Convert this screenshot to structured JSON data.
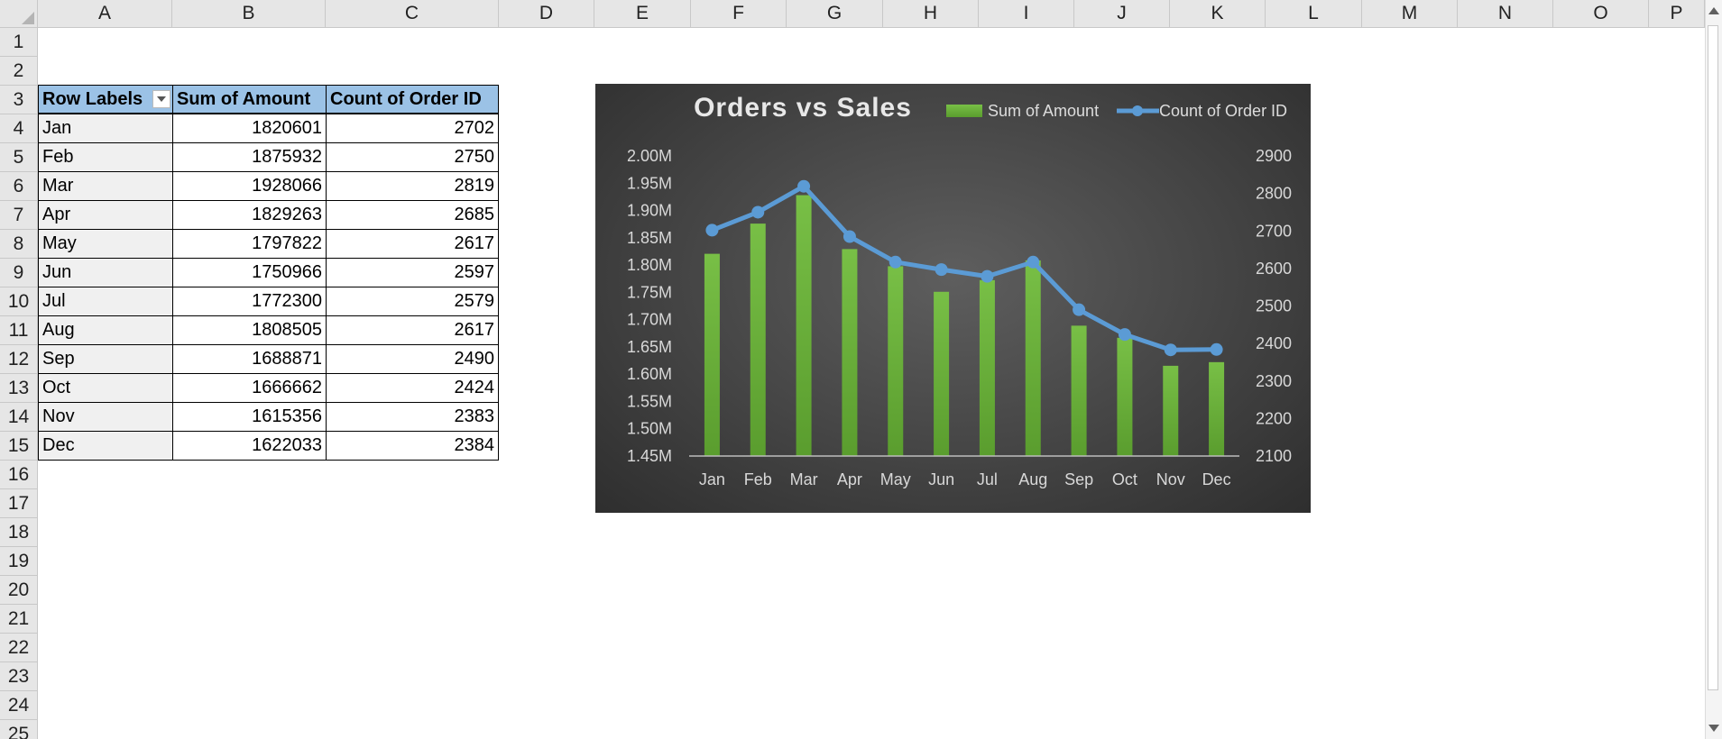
{
  "columns": [
    "A",
    "B",
    "C",
    "D",
    "E",
    "F",
    "G",
    "H",
    "I",
    "J",
    "K",
    "L",
    "M",
    "N",
    "O",
    "P"
  ],
  "rows": [
    "1",
    "2",
    "3",
    "4",
    "5",
    "6",
    "7",
    "8",
    "9",
    "10",
    "11",
    "12",
    "13",
    "14",
    "15",
    "16",
    "17",
    "18",
    "19",
    "20",
    "21",
    "22",
    "23",
    "24",
    "25"
  ],
  "pivot": {
    "headers": [
      "Row Labels",
      "Sum of Amount",
      "Count of Order ID"
    ],
    "rows": [
      {
        "label": "Jan",
        "amount": "1820601",
        "count": "2702"
      },
      {
        "label": "Feb",
        "amount": "1875932",
        "count": "2750"
      },
      {
        "label": "Mar",
        "amount": "1928066",
        "count": "2819"
      },
      {
        "label": "Apr",
        "amount": "1829263",
        "count": "2685"
      },
      {
        "label": "May",
        "amount": "1797822",
        "count": "2617"
      },
      {
        "label": "Jun",
        "amount": "1750966",
        "count": "2597"
      },
      {
        "label": "Jul",
        "amount": "1772300",
        "count": "2579"
      },
      {
        "label": "Aug",
        "amount": "1808505",
        "count": "2617"
      },
      {
        "label": "Sep",
        "amount": "1688871",
        "count": "2490"
      },
      {
        "label": "Oct",
        "amount": "1666662",
        "count": "2424"
      },
      {
        "label": "Nov",
        "amount": "1615356",
        "count": "2383"
      },
      {
        "label": "Dec",
        "amount": "1622033",
        "count": "2384"
      }
    ]
  },
  "chart_data": {
    "type": "bar",
    "title": "Orders vs Sales",
    "categories": [
      "Jan",
      "Feb",
      "Mar",
      "Apr",
      "May",
      "Jun",
      "Jul",
      "Aug",
      "Sep",
      "Oct",
      "Nov",
      "Dec"
    ],
    "series": [
      {
        "name": "Sum of Amount",
        "type": "bar",
        "axis": "left",
        "color": "#6db33f",
        "values": [
          1820601,
          1875932,
          1928066,
          1829263,
          1797822,
          1750966,
          1772300,
          1808505,
          1688871,
          1666662,
          1615356,
          1622033
        ]
      },
      {
        "name": "Count of Order ID",
        "type": "line",
        "axis": "right",
        "color": "#5b9bd5",
        "values": [
          2702,
          2750,
          2819,
          2685,
          2617,
          2597,
          2579,
          2617,
          2490,
          2424,
          2383,
          2384
        ]
      }
    ],
    "y_left": {
      "min": 1450000,
      "max": 2000000,
      "ticks": [
        "2.00M",
        "1.95M",
        "1.90M",
        "1.85M",
        "1.80M",
        "1.75M",
        "1.70M",
        "1.65M",
        "1.60M",
        "1.55M",
        "1.50M",
        "1.45M"
      ]
    },
    "y_right": {
      "min": 2100,
      "max": 2900,
      "ticks": [
        "2900",
        "2800",
        "2700",
        "2600",
        "2500",
        "2400",
        "2300",
        "2200",
        "2100"
      ]
    },
    "legend": "top-right",
    "grid": false
  }
}
